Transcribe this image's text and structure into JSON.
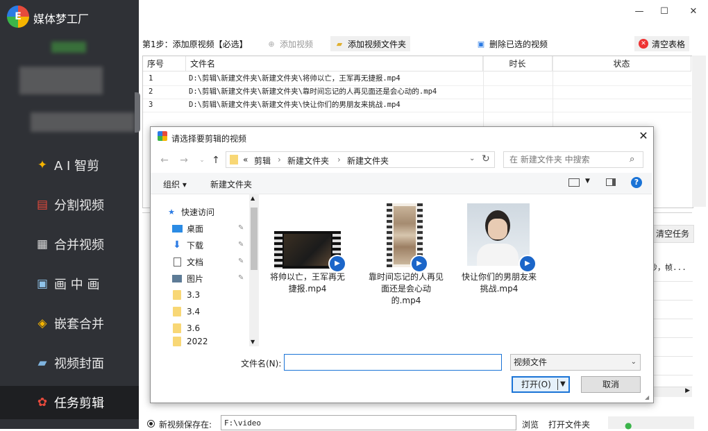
{
  "app": {
    "title": "媒体梦工厂",
    "logo_text": "E",
    "colors": {
      "sidebar_bg": "#2f3136",
      "sidebar_active": "#1e1f22",
      "accent": "#1a73d6"
    }
  },
  "sidebar": {
    "items": [
      {
        "label": "A I 智剪",
        "icon": "ai-cut-icon"
      },
      {
        "label": "分割视频",
        "icon": "split-video-icon"
      },
      {
        "label": "合并视频",
        "icon": "merge-video-icon"
      },
      {
        "label": "画 中 画",
        "icon": "picture-in-picture-icon"
      },
      {
        "label": "嵌套合并",
        "icon": "nested-merge-icon"
      },
      {
        "label": "视频封面",
        "icon": "video-cover-icon"
      },
      {
        "label": "任务剪辑",
        "icon": "task-edit-icon",
        "active": true
      }
    ]
  },
  "window": {
    "minimize": "—",
    "maximize": "☐",
    "close": "✕"
  },
  "toolbar": {
    "step1": "第1步：添加原视频【必选】",
    "add_video": "添加视频",
    "add_folder": "添加视频文件夹",
    "delete_selected": "删除已选的视频",
    "clear_table": "清空表格"
  },
  "table": {
    "headers": [
      "序号",
      "文件名",
      "时长",
      "状态"
    ],
    "rows": [
      {
        "index": "1",
        "filename": "D:\\剪辑\\新建文件夹\\新建文件夹\\将帅以亡，王军再无捷报.mp4"
      },
      {
        "index": "2",
        "filename": "D:\\剪辑\\新建文件夹\\新建文件夹\\靠时间忘记的人再见面还是会心动的.mp4"
      },
      {
        "index": "3",
        "filename": "D:\\剪辑\\新建文件夹\\新建文件夹\\快让你们的男朋友来挑战.mp4"
      }
    ]
  },
  "task_panel": {
    "clear_tasks": "清空任务",
    "status_text": "秒，帧..."
  },
  "save": {
    "label": "新视频保存在:",
    "path": "F:\\video",
    "browse": "浏览",
    "open_folder": "打开文件夹"
  },
  "dialog": {
    "title": "请选择要剪辑的视频",
    "address": {
      "prefix": "«",
      "segments": [
        "剪辑",
        "新建文件夹",
        "新建文件夹"
      ]
    },
    "search_placeholder": "在 新建文件夹 中搜索",
    "organize": "组织 ▾",
    "new_folder": "新建文件夹",
    "tree": [
      {
        "label": "快速访问",
        "icon": "star-icon"
      },
      {
        "label": "桌面",
        "icon": "desktop-icon",
        "pinned": true
      },
      {
        "label": "下载",
        "icon": "download-icon",
        "pinned": true
      },
      {
        "label": "文档",
        "icon": "document-icon",
        "pinned": true
      },
      {
        "label": "图片",
        "icon": "picture-icon",
        "pinned": true
      },
      {
        "label": "3.3",
        "icon": "folder-icon"
      },
      {
        "label": "3.4",
        "icon": "folder-icon"
      },
      {
        "label": "3.6",
        "icon": "folder-icon"
      },
      {
        "label": "2022",
        "icon": "folder-icon"
      }
    ],
    "files": [
      {
        "name": "将帅以亡，王军再无捷报.mp4"
      },
      {
        "name": "靠时间忘记的人再见面还是会心动的.mp4"
      },
      {
        "name": "快让你们的男朋友来挑战.mp4"
      }
    ],
    "filename_label": "文件名(N):",
    "filename_value": "",
    "filetype": "视频文件",
    "open_button": "打开(O)",
    "cancel_button": "取消"
  }
}
